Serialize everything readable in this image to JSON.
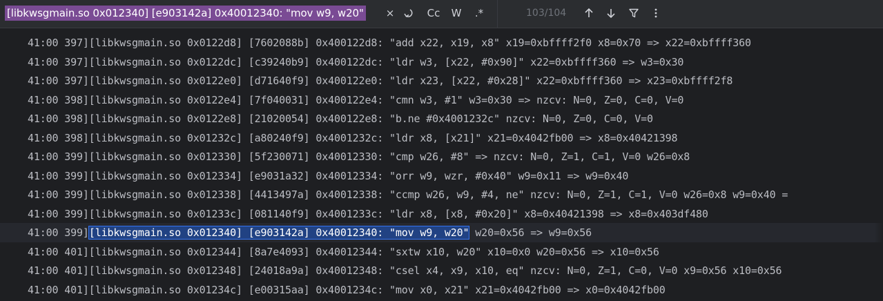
{
  "search": {
    "query": "[libkwsgmain.so 0x012340] [e903142a] 0x40012340: \"mov w9, w20\"",
    "clear_glyph": "×",
    "replace_glyph": "↵",
    "match_case_label": "Cc",
    "whole_words_label": "W",
    "regex_label": ".*",
    "counter": "103/104",
    "colors": {
      "highlight": "#7a4b94",
      "match_outline": "#3574f0"
    }
  },
  "log": {
    "rows": [
      {
        "pre": "41:00 397][libkwsgmain.so 0x0122d8] [7602088b] 0x400122d8: \"add x22, x19, x8\" x19=0xbffff2f0 x8=0x70 => x22=0xbffff360"
      },
      {
        "pre": "41:00 397][libkwsgmain.so 0x0122dc] [c39240b9] 0x400122dc: \"ldr w3, [x22, #0x90]\" x22=0xbffff360 => w3=0x30"
      },
      {
        "pre": "41:00 397][libkwsgmain.so 0x0122e0] [d71640f9] 0x400122e0: \"ldr x23, [x22, #0x28]\" x22=0xbffff360 => x23=0xbffff2f8"
      },
      {
        "pre": "41:00 398][libkwsgmain.so 0x0122e4] [7f040031] 0x400122e4: \"cmn w3, #1\" w3=0x30 => nzcv: N=0, Z=0, C=0, V=0"
      },
      {
        "pre": "41:00 398][libkwsgmain.so 0x0122e8] [21020054] 0x400122e8: \"b.ne #0x4001232c\" nzcv: N=0, Z=0, C=0, V=0"
      },
      {
        "pre": "41:00 398][libkwsgmain.so 0x01232c] [a80240f9] 0x4001232c: \"ldr x8, [x21]\" x21=0x4042fb00 => x8=0x40421398"
      },
      {
        "pre": "41:00 399][libkwsgmain.so 0x012330] [5f230071] 0x40012330: \"cmp w26, #8\" => nzcv: N=0, Z=1, C=1, V=0 w26=0x8"
      },
      {
        "pre": "41:00 399][libkwsgmain.so 0x012334] [e9031a32] 0x40012334: \"orr w9, wzr, #0x40\" w9=0x11 => w9=0x40"
      },
      {
        "pre": "41:00 399][libkwsgmain.so 0x012338] [4413497a] 0x40012338: \"ccmp w26, w9, #4, ne\" nzcv: N=0, Z=1, C=1, V=0 w26=0x8 w9=0x40 ="
      },
      {
        "pre": "41:00 399][libkwsgmain.so 0x01233c] [081140f9] 0x4001233c: \"ldr x8, [x8, #0x20]\" x8=0x40421398 => x8=0x403df480"
      },
      {
        "pre": "41:00 399]",
        "match": "[libkwsgmain.so 0x012340] [e903142a] 0x40012340: \"mov w9, w20\"",
        "post": " w20=0x56 => w9=0x56"
      },
      {
        "pre": "41:00 401][libkwsgmain.so 0x012344] [8a7e4093] 0x40012344: \"sxtw x10, w20\" x10=0x0 w20=0x56 => x10=0x56"
      },
      {
        "pre": "41:00 401][libkwsgmain.so 0x012348] [24018a9a] 0x40012348: \"csel x4, x9, x10, eq\" nzcv: N=0, Z=1, C=0, V=0 x9=0x56 x10=0x56"
      },
      {
        "pre": "41:00 401][libkwsgmain.so 0x01234c] [e00315aa] 0x4001234c: \"mov x0, x21\" x21=0x4042fb00 => x0=0x4042fb00"
      }
    ]
  }
}
